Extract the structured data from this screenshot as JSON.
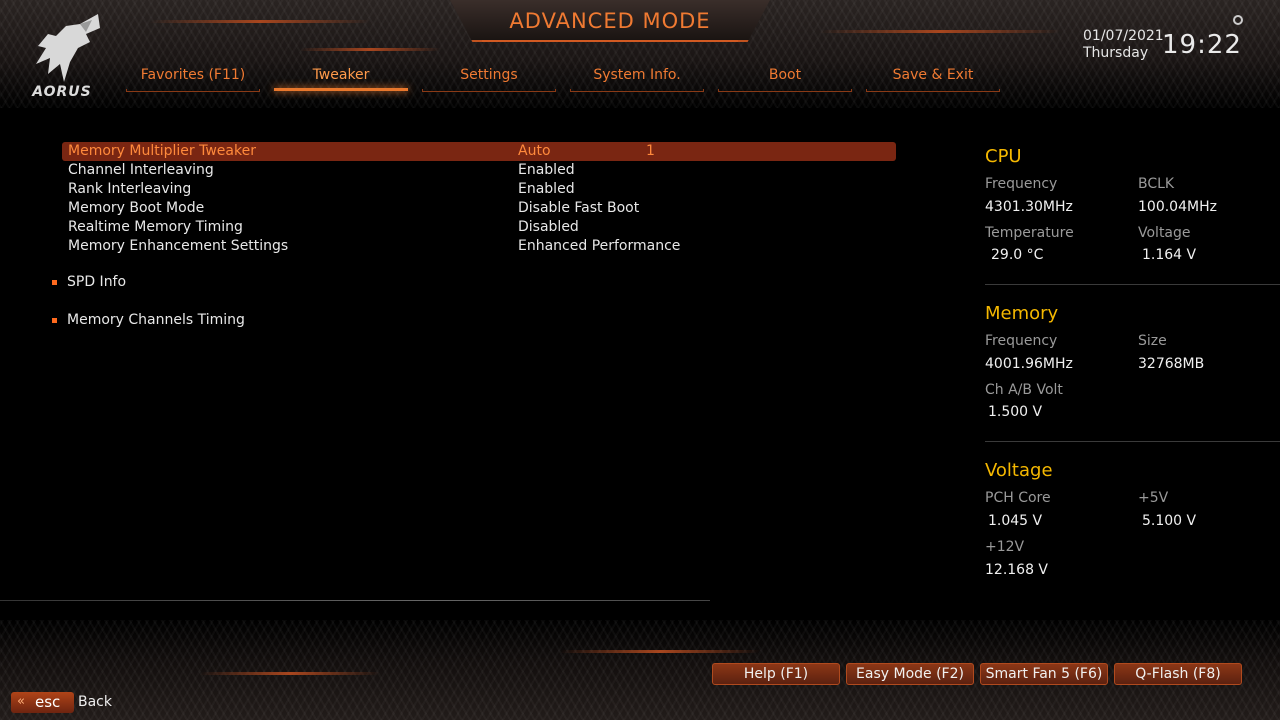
{
  "header": {
    "title": "ADVANCED MODE",
    "logo_text": "AORUS",
    "date": "01/07/2021",
    "day": "Thursday",
    "time": "19:22"
  },
  "tabs": [
    {
      "label": "Favorites (F11)",
      "active": false
    },
    {
      "label": "Tweaker",
      "active": true
    },
    {
      "label": "Settings",
      "active": false
    },
    {
      "label": "System Info.",
      "active": false
    },
    {
      "label": "Boot",
      "active": false
    },
    {
      "label": "Save & Exit",
      "active": false
    }
  ],
  "settings": [
    {
      "label": "Memory Multiplier Tweaker",
      "value": "Auto",
      "extra": "1",
      "selected": true
    },
    {
      "label": "Channel Interleaving",
      "value": "Enabled"
    },
    {
      "label": "Rank Interleaving",
      "value": "Enabled"
    },
    {
      "label": "Memory Boot Mode",
      "value": "Disable Fast Boot"
    },
    {
      "label": "Realtime Memory Timing",
      "value": "Disabled"
    },
    {
      "label": "Memory Enhancement Settings",
      "value": "Enhanced Performance"
    }
  ],
  "submenus": [
    {
      "label": "SPD Info"
    },
    {
      "label": "Memory Channels Timing"
    }
  ],
  "cpu": {
    "title": "CPU",
    "frequency_label": "Frequency",
    "frequency": "4301.30MHz",
    "bclk_label": "BCLK",
    "bclk": "100.04MHz",
    "temp_label": "Temperature",
    "temp": "29.0 °C",
    "voltage_label": "Voltage",
    "voltage": "1.164 V"
  },
  "memory": {
    "title": "Memory",
    "frequency_label": "Frequency",
    "frequency": "4001.96MHz",
    "size_label": "Size",
    "size": "32768MB",
    "chab_label": "Ch A/B Volt",
    "chab": "1.500 V"
  },
  "voltage": {
    "title": "Voltage",
    "pch_label": "PCH Core",
    "pch": "1.045 V",
    "p5_label": "+5V",
    "p5": "5.100 V",
    "p12_label": "+12V",
    "p12": "12.168 V"
  },
  "footer": {
    "help": "Help (F1)",
    "easy": "Easy Mode (F2)",
    "fan": "Smart Fan 5 (F6)",
    "qflash": "Q-Flash (F8)",
    "esc": "esc",
    "back": "Back"
  },
  "colors": {
    "accent": "#f07a32",
    "selected_row": "#7a2612",
    "panel_heading": "#f5b800"
  }
}
